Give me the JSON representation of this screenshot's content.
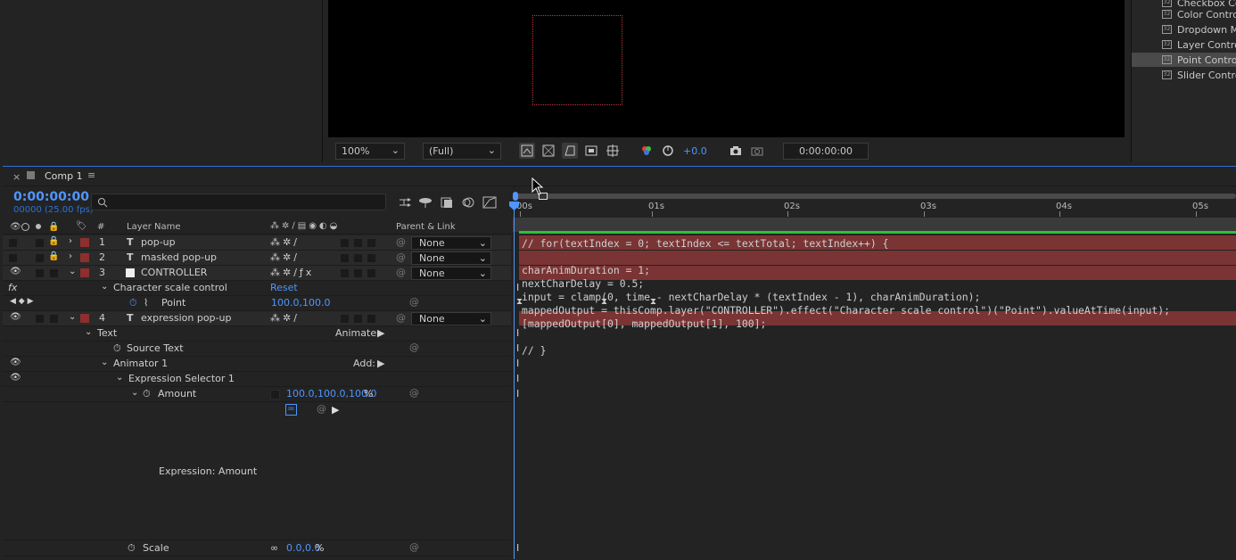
{
  "effects_panel": {
    "items": [
      "Checkbox Control",
      "Color Control",
      "Dropdown Menu Control",
      "Layer Control",
      "Point Control",
      "Slider Control"
    ],
    "selected": "Point Control"
  },
  "viewer": {
    "zoom": "100%",
    "resolution": "(Full)",
    "exposure": "+0.0",
    "timecode": "0:00:00:00"
  },
  "comp": {
    "tab_title": "Comp 1",
    "current_time": "0:00:00:00",
    "frame_info": "00000 (25.00 fps)",
    "search_placeholder": "",
    "col_num": "#",
    "col_layer_name": "Layer Name",
    "col_parent": "Parent & Link"
  },
  "ruler": {
    "labels": [
      "00s",
      "01s",
      "02s",
      "03s",
      "04s",
      "05s"
    ]
  },
  "layers": [
    {
      "num": "1",
      "type": "T",
      "name": "pop-up",
      "parent": "None"
    },
    {
      "num": "2",
      "type": "T",
      "name": "masked pop-up",
      "parent": "None"
    },
    {
      "num": "3",
      "type": "solid",
      "name": "CONTROLLER",
      "parent": "None"
    },
    {
      "num": "4",
      "type": "T",
      "name": "expression pop-up",
      "parent": "None"
    }
  ],
  "props": {
    "fx_label": "fx",
    "effect_name": "Character scale control",
    "reset": "Reset",
    "point_name": "Point",
    "point_value": "100.0,100.0",
    "text_group": "Text",
    "animate_label": "Animate:",
    "source_text": "Source Text",
    "animator": "Animator 1",
    "add_label": "Add:",
    "selector": "Expression Selector 1",
    "amount": "Amount",
    "amount_value": "100.0,100.0,100.0",
    "amount_unit": "%",
    "expression_label": "Expression: Amount",
    "scale": "Scale",
    "scale_value": "0.0,0.0",
    "scale_unit": "%"
  },
  "expression_code": "// for(textIndex = 0; textIndex <= textTotal; textIndex++) {\n\ncharAnimDuration = 1;\nnextCharDelay = 0.5;\ninput = clamp(0, time - nextCharDelay * (textIndex - 1), charAnimDuration);\nmappedOutput = thisComp.layer(\"CONTROLLER\").effect(\"Character scale control\")(\"Point\").valueAtTime(input);\n[mappedOutput[0], mappedOutput[1], 100];\n\n// }",
  "colors": {
    "accent_blue": "#4f96ff",
    "layer_bar": "#7a3434",
    "label_red": "#8e2f2f",
    "work_area_green": "#2fbf3a"
  }
}
